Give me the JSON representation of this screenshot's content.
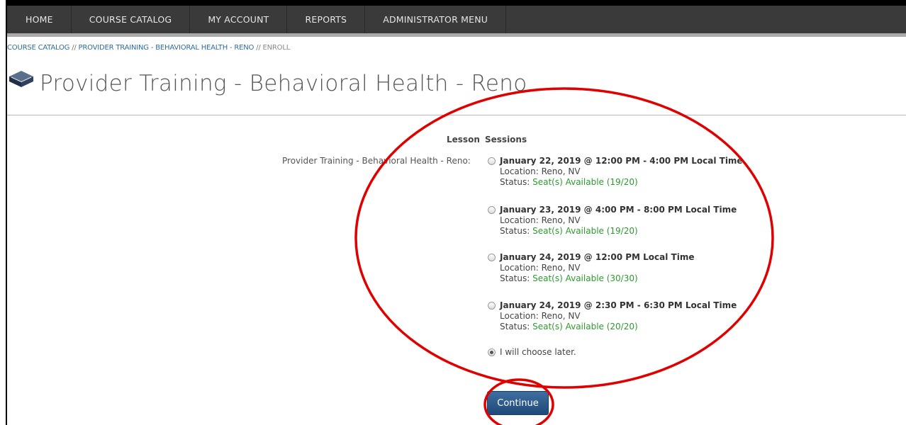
{
  "nav": {
    "items": [
      "HOME",
      "COURSE CATALOG",
      "MY ACCOUNT",
      "REPORTS",
      "ADMINISTRATOR MENU"
    ]
  },
  "breadcrumb": {
    "catalog": "COURSE CATALOG",
    "course": "PROVIDER TRAINING - BEHAVIORAL HEALTH - RENO",
    "current": "ENROLL",
    "separator": "//"
  },
  "page": {
    "title": "Provider Training - Behavioral Health - Reno",
    "icon": "book-icon"
  },
  "table": {
    "header_lesson": "Lesson",
    "header_sessions": "Sessions",
    "lesson_name": "Provider Training - Behavioral Health - Reno:"
  },
  "sessions": [
    {
      "title": "January 22, 2019 @ 12:00 PM - 4:00 PM Local Time",
      "location": "Location: Reno, NV",
      "status_label": "Status:",
      "status": "Seat(s) Available (19/20)",
      "selected": false
    },
    {
      "title": "January 23, 2019 @ 4:00 PM - 8:00 PM Local Time",
      "location": "Location: Reno, NV",
      "status_label": "Status:",
      "status": "Seat(s) Available (19/20)",
      "selected": false
    },
    {
      "title": "January 24, 2019 @ 12:00 PM Local Time",
      "location": "Location: Reno, NV",
      "status_label": "Status:",
      "status": "Seat(s) Available (30/30)",
      "selected": false
    },
    {
      "title": "January 24, 2019 @ 2:30 PM - 6:30 PM Local Time",
      "location": "Location: Reno, NV",
      "status_label": "Status:",
      "status": "Seat(s) Available (20/20)",
      "selected": false
    }
  ],
  "choose_later": {
    "label": "I will choose later.",
    "selected": true
  },
  "actions": {
    "continue_label": "Continue"
  },
  "colors": {
    "nav_bg": "#3a3a3a",
    "link": "#2e6ca4",
    "status_available": "#2d9a2d",
    "button": "#2a5a8c",
    "annotation": "#e00000"
  }
}
